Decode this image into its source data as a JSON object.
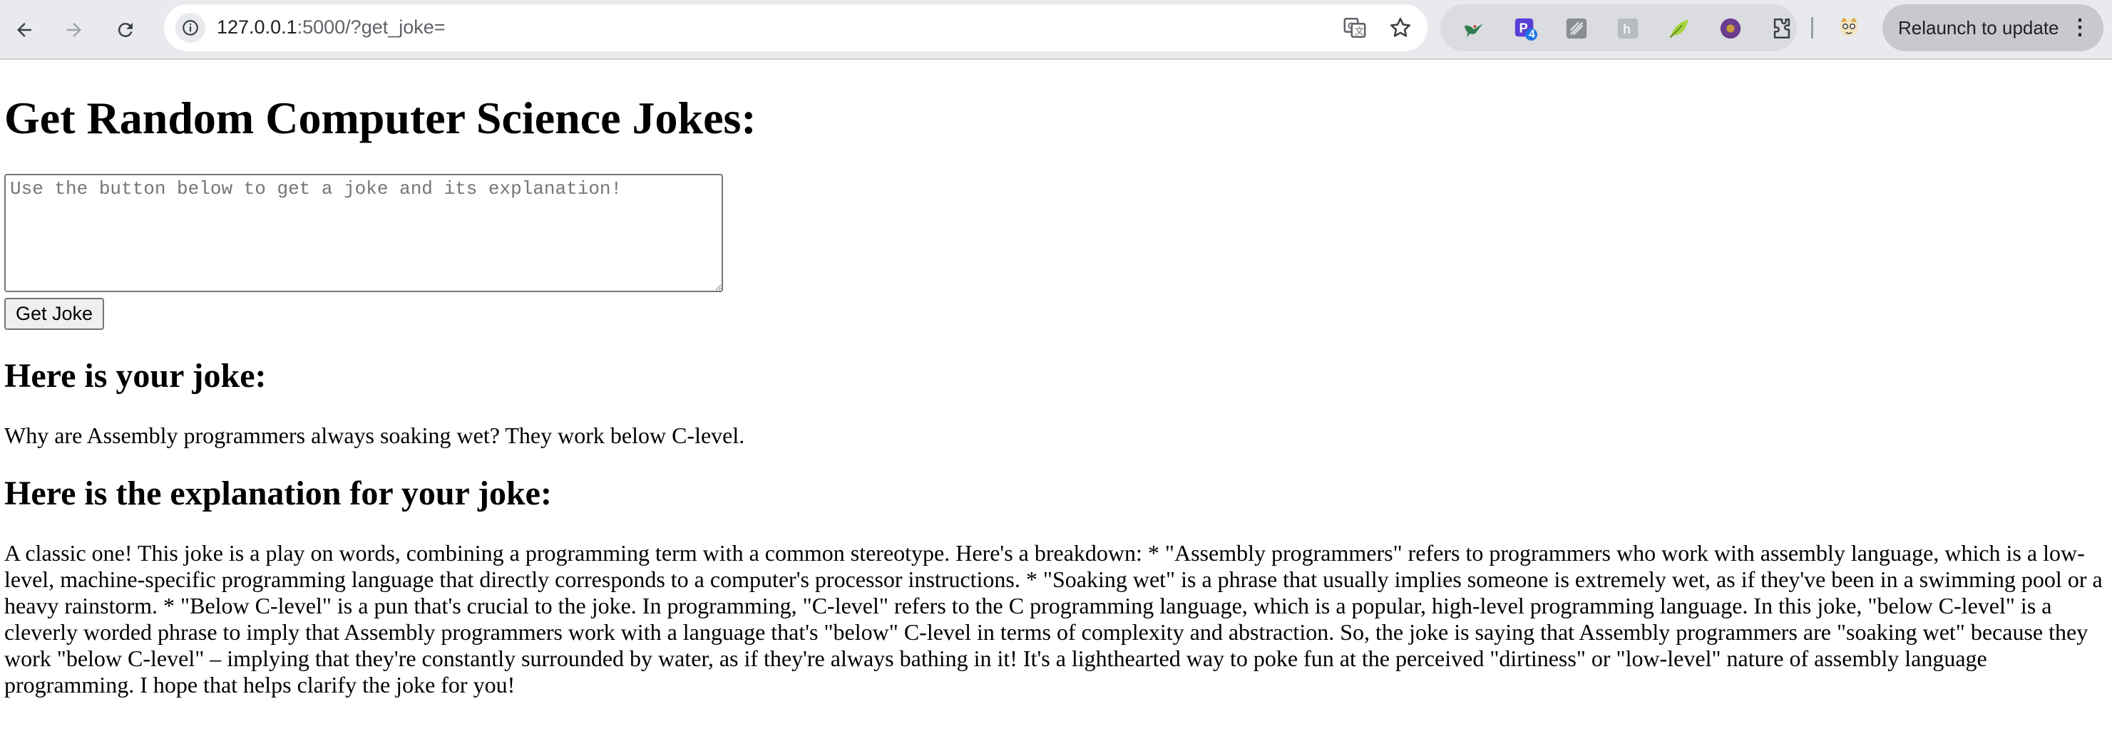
{
  "browser": {
    "url_host": "127.0.0.1",
    "url_path": ":5000/?get_joke=",
    "relaunch_label": "Relaunch to update",
    "extension_badge": "4",
    "icons": [
      "back-icon",
      "forward-icon",
      "reload-icon",
      "site-info-icon",
      "translate-icon",
      "bookmark-star-icon",
      "extensions-puzzle-icon",
      "profile-avatar-icon"
    ]
  },
  "page": {
    "title": "Get Random Computer Science Jokes:",
    "textarea_placeholder": "Use the button below to get a joke and its explanation!",
    "button_label": "Get Joke",
    "joke_heading": "Here is your joke:",
    "joke_text": "Why are Assembly programmers always soaking wet? They work below C-level.",
    "explanation_heading": "Here is the explanation for your joke:",
    "explanation_text": "A classic one! This joke is a play on words, combining a programming term with a common stereotype. Here's a breakdown: * \"Assembly programmers\" refers to programmers who work with assembly language, which is a low-level, machine-specific programming language that directly corresponds to a computer's processor instructions. * \"Soaking wet\" is a phrase that usually implies someone is extremely wet, as if they've been in a swimming pool or a heavy rainstorm. * \"Below C-level\" is a pun that's crucial to the joke. In programming, \"C-level\" refers to the C programming language, which is a popular, high-level programming language. In this joke, \"below C-level\" is a cleverly worded phrase to imply that Assembly programmers work with a language that's \"below\" C-level in terms of complexity and abstraction. So, the joke is saying that Assembly programmers are \"soaking wet\" because they work \"below C-level\" – implying that they're constantly surrounded by water, as if they're always bathing in it! It's a lighthearted way to poke fun at the perceived \"dirtiness\" or \"low-level\" nature of assembly language programming. I hope that helps clarify the joke for you!"
  }
}
